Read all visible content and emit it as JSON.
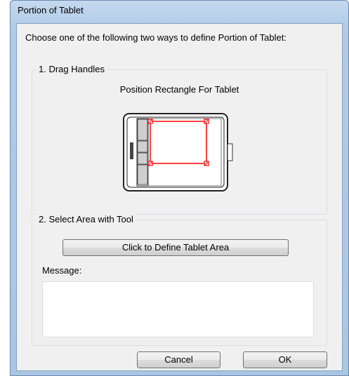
{
  "dialog": {
    "title": "Portion of Tablet",
    "intro": "Choose one of the following two ways to define Portion of Tablet:"
  },
  "drag_handles": {
    "legend": "1. Drag Handles",
    "caption": "Position Rectangle For Tablet"
  },
  "select_area": {
    "legend": "2. Select Area with Tool",
    "define_button": "Click to Define Tablet Area",
    "message_label": "Message:",
    "message_text": ""
  },
  "footer": {
    "cancel": "Cancel",
    "ok": "OK"
  },
  "colors": {
    "selection_rect": "#ff0000",
    "title_bar": "#b0cbe6"
  }
}
